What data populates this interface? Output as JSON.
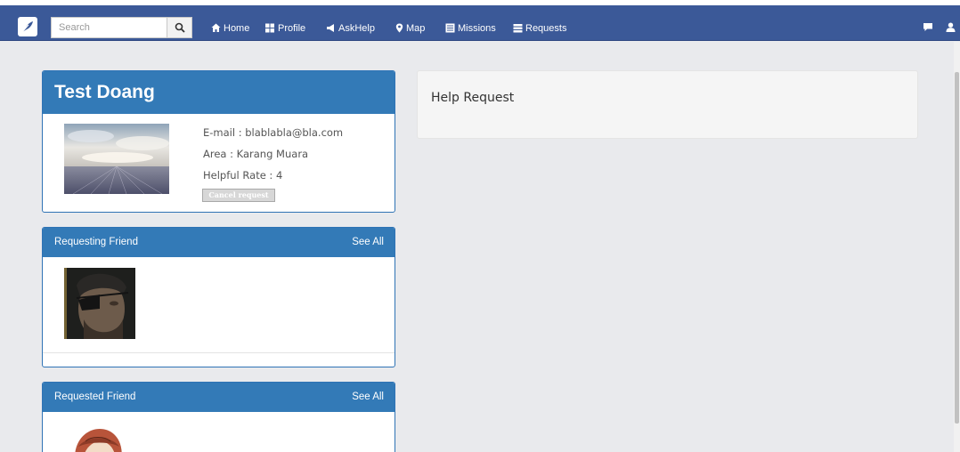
{
  "navbar": {
    "search_placeholder": "Search",
    "items": [
      {
        "label": "Home",
        "icon": "home-icon"
      },
      {
        "label": "Profile",
        "icon": "grid-icon"
      },
      {
        "label": "AskHelp",
        "icon": "megaphone-icon"
      },
      {
        "label": "Map",
        "icon": "map-pin-icon"
      },
      {
        "label": "Missions",
        "icon": "list-icon"
      },
      {
        "label": "Requests",
        "icon": "list-icon"
      }
    ],
    "right_icons": [
      "chat-icon",
      "user-icon"
    ]
  },
  "profile": {
    "name": "Test Doang",
    "email_line": "E-mail : blablabla@bla.com",
    "area_line": "Area : Karang Muara",
    "rate_line": "Helpful Rate : 4",
    "cancel_label": "Cancel request"
  },
  "requesting_friend": {
    "title": "Requesting Friend",
    "see_all": "See All"
  },
  "requested_friend": {
    "title": "Requested Friend",
    "see_all": "See All"
  },
  "help_request": {
    "title": "Help Request"
  },
  "colors": {
    "navbar": "#3b5998",
    "panel_header": "#337ab7",
    "background": "#e9eaed"
  }
}
